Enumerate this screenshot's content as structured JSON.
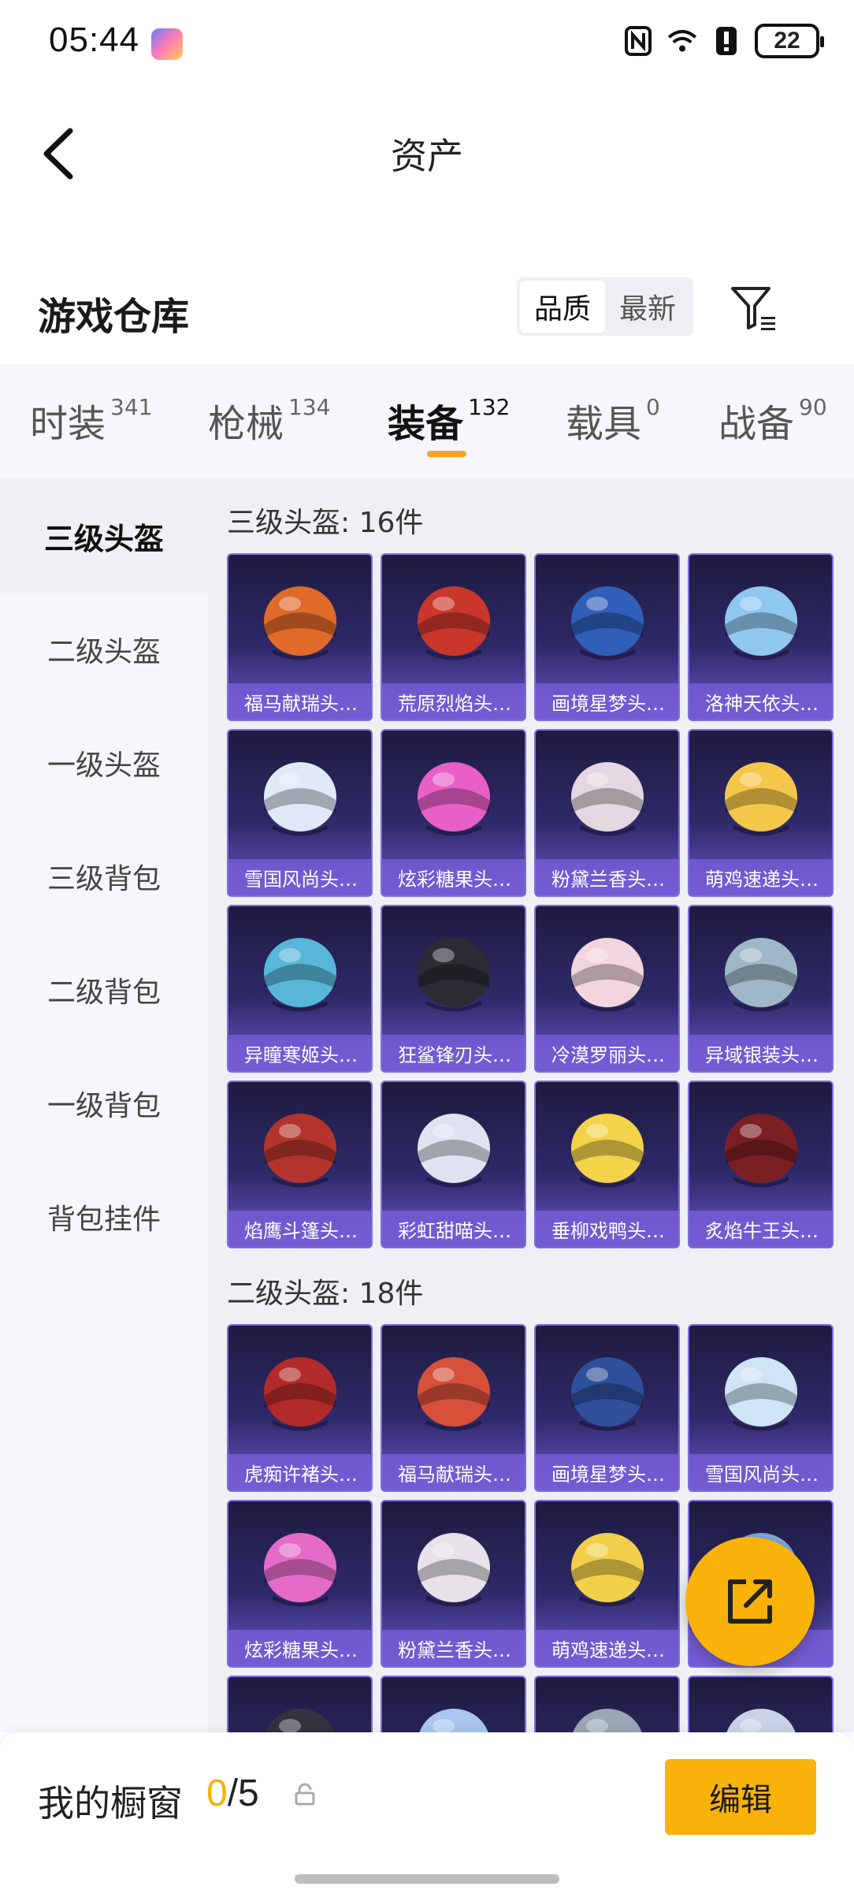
{
  "status": {
    "time": "05:44",
    "battery": "22"
  },
  "nav": {
    "title": "资产"
  },
  "warehouse": {
    "title": "游戏仓库",
    "sort_options": [
      "品质",
      "最新"
    ]
  },
  "categories": [
    {
      "label": "时装",
      "count": "341"
    },
    {
      "label": "枪械",
      "count": "134"
    },
    {
      "label": "装备",
      "count": "132",
      "active": true
    },
    {
      "label": "载具",
      "count": "0"
    },
    {
      "label": "战备",
      "count": "90"
    }
  ],
  "sidebar": [
    "三级头盔",
    "二级头盔",
    "一级头盔",
    "三级背包",
    "二级背包",
    "一级背包",
    "背包挂件"
  ],
  "sections": [
    {
      "title": "三级头盔: 16件",
      "items": [
        "福马献瑞头…",
        "荒原烈焰头…",
        "画境星梦头…",
        "洛神天依头…",
        "雪国风尚头…",
        "炫彩糖果头…",
        "粉黛兰香头…",
        "萌鸡速递头…",
        "异瞳寒姬头…",
        "狂鲨锋刃头…",
        "冷漠罗丽头…",
        "异域银装头…",
        "焰鹰斗篷头…",
        "彩虹甜喵头…",
        "垂柳戏鸭头…",
        "炙焰牛王头…"
      ]
    },
    {
      "title": "二级头盔: 18件",
      "items": [
        "虎痴许褚头…",
        "福马献瑞头…",
        "画境星梦头…",
        "雪国风尚头…",
        "炫彩糖果头…",
        "粉黛兰香头…",
        "萌鸡速递头…",
        "",
        "",
        "",
        "",
        ""
      ]
    }
  ],
  "colors": [
    "#e06a2a",
    "#c9362a",
    "#2f5fb8",
    "#8fc7ef",
    "#dfe9f7",
    "#e85fc7",
    "#e4d7df",
    "#f4c64a",
    "#58b6d8",
    "#2b2b33",
    "#f2d6de",
    "#9fb8c8",
    "#b3342c",
    "#dfe3f0",
    "#f2d34a",
    "#7a1f22",
    "#b32a2a",
    "#d6503a",
    "#2e4f9a",
    "#cfe4f5",
    "#e46cc8",
    "#e7e2ea",
    "#f2cf4a",
    "#7fa8d9",
    "#333340",
    "#a8c6ef",
    "#9aa5b5",
    "#c9d2e6"
  ],
  "showcase": {
    "label": "我的橱窗",
    "current": "0",
    "max": "/5",
    "edit_label": "编辑"
  }
}
